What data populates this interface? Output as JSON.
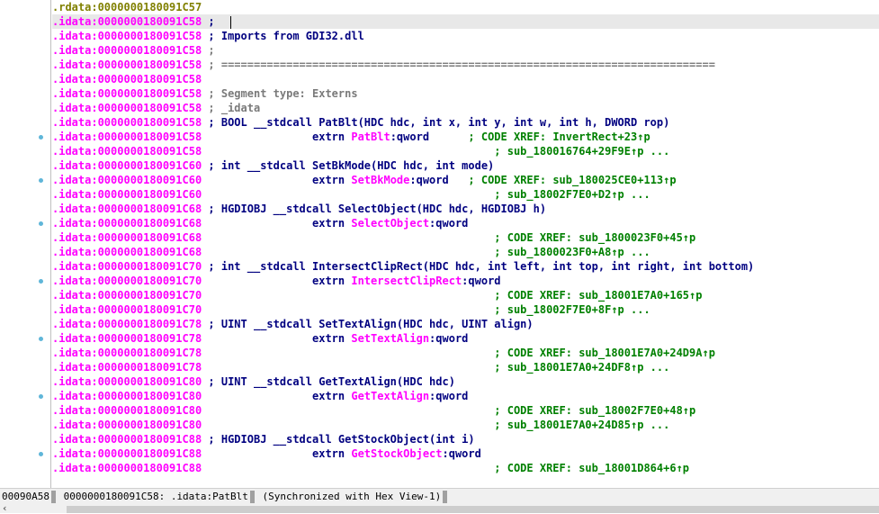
{
  "rows": [
    {
      "seg": "rdata",
      "addr": ".rdata:0000000180091C57",
      "text": ""
    },
    {
      "seg": "idata",
      "addr": ".idata:0000000180091C58",
      "text": " ; ",
      "sel": true,
      "caret": true
    },
    {
      "seg": "idata",
      "addr": ".idata:0000000180091C58",
      "parts": [
        {
          "c": "decl",
          "t": " ; Imports from GDI32.dll"
        }
      ]
    },
    {
      "seg": "idata",
      "addr": ".idata:0000000180091C58",
      "parts": [
        {
          "c": "cmt",
          "t": " ;"
        }
      ]
    },
    {
      "seg": "idata",
      "addr": ".idata:0000000180091C58",
      "parts": [
        {
          "c": "cmt",
          "t": " ; ============================================================================"
        }
      ]
    },
    {
      "seg": "idata",
      "addr": ".idata:0000000180091C58",
      "parts": []
    },
    {
      "seg": "idata",
      "addr": ".idata:0000000180091C58",
      "parts": [
        {
          "c": "cmt",
          "t": " ; Segment type: Externs"
        }
      ]
    },
    {
      "seg": "idata",
      "addr": ".idata:0000000180091C58",
      "parts": [
        {
          "c": "cmt",
          "t": " ; _idata"
        }
      ]
    },
    {
      "seg": "idata",
      "addr": ".idata:0000000180091C58",
      "parts": [
        {
          "c": "decl",
          "t": " ; BOOL __stdcall PatBlt(HDC hdc, int x, int y, int w, int h, DWORD rop)"
        }
      ]
    },
    {
      "seg": "idata",
      "addr": ".idata:0000000180091C58",
      "dot": true,
      "parts": [
        {
          "c": "plain",
          "t": "                 extrn "
        },
        {
          "c": "name",
          "t": "PatBlt"
        },
        {
          "c": "plain",
          "t": ":qword      "
        },
        {
          "c": "xref",
          "t": "; CODE XREF: InvertRect+23↑p"
        }
      ]
    },
    {
      "seg": "idata",
      "addr": ".idata:0000000180091C58",
      "parts": [
        {
          "c": "plain",
          "t": "                                             "
        },
        {
          "c": "xref",
          "t": "; sub_180016764+29F9E↑p ..."
        }
      ]
    },
    {
      "seg": "idata",
      "addr": ".idata:0000000180091C60",
      "parts": [
        {
          "c": "decl",
          "t": " ; int __stdcall SetBkMode(HDC hdc, int mode)"
        }
      ]
    },
    {
      "seg": "idata",
      "addr": ".idata:0000000180091C60",
      "dot": true,
      "parts": [
        {
          "c": "plain",
          "t": "                 extrn "
        },
        {
          "c": "name",
          "t": "SetBkMode"
        },
        {
          "c": "plain",
          "t": ":qword   "
        },
        {
          "c": "xref",
          "t": "; CODE XREF: sub_180025CE0+113↑p"
        }
      ]
    },
    {
      "seg": "idata",
      "addr": ".idata:0000000180091C60",
      "parts": [
        {
          "c": "plain",
          "t": "                                             "
        },
        {
          "c": "xref",
          "t": "; sub_18002F7E0+D2↑p ..."
        }
      ]
    },
    {
      "seg": "idata",
      "addr": ".idata:0000000180091C68",
      "parts": [
        {
          "c": "decl",
          "t": " ; HGDIOBJ __stdcall SelectObject(HDC hdc, HGDIOBJ h)"
        }
      ]
    },
    {
      "seg": "idata",
      "addr": ".idata:0000000180091C68",
      "dot": true,
      "parts": [
        {
          "c": "plain",
          "t": "                 extrn "
        },
        {
          "c": "name",
          "t": "SelectObject"
        },
        {
          "c": "plain",
          "t": ":qword"
        }
      ]
    },
    {
      "seg": "idata",
      "addr": ".idata:0000000180091C68",
      "parts": [
        {
          "c": "plain",
          "t": "                                             "
        },
        {
          "c": "xref",
          "t": "; CODE XREF: sub_1800023F0+45↑p"
        }
      ]
    },
    {
      "seg": "idata",
      "addr": ".idata:0000000180091C68",
      "parts": [
        {
          "c": "plain",
          "t": "                                             "
        },
        {
          "c": "xref",
          "t": "; sub_1800023F0+A8↑p ..."
        }
      ]
    },
    {
      "seg": "idata",
      "addr": ".idata:0000000180091C70",
      "parts": [
        {
          "c": "decl",
          "t": " ; int __stdcall IntersectClipRect(HDC hdc, int left, int top, int right, int bottom)"
        }
      ]
    },
    {
      "seg": "idata",
      "addr": ".idata:0000000180091C70",
      "dot": true,
      "parts": [
        {
          "c": "plain",
          "t": "                 extrn "
        },
        {
          "c": "name",
          "t": "IntersectClipRect"
        },
        {
          "c": "plain",
          "t": ":qword"
        }
      ]
    },
    {
      "seg": "idata",
      "addr": ".idata:0000000180091C70",
      "parts": [
        {
          "c": "plain",
          "t": "                                             "
        },
        {
          "c": "xref",
          "t": "; CODE XREF: sub_18001E7A0+165↑p"
        }
      ]
    },
    {
      "seg": "idata",
      "addr": ".idata:0000000180091C70",
      "parts": [
        {
          "c": "plain",
          "t": "                                             "
        },
        {
          "c": "xref",
          "t": "; sub_18002F7E0+8F↑p ..."
        }
      ]
    },
    {
      "seg": "idata",
      "addr": ".idata:0000000180091C78",
      "parts": [
        {
          "c": "decl",
          "t": " ; UINT __stdcall SetTextAlign(HDC hdc, UINT align)"
        }
      ]
    },
    {
      "seg": "idata",
      "addr": ".idata:0000000180091C78",
      "dot": true,
      "parts": [
        {
          "c": "plain",
          "t": "                 extrn "
        },
        {
          "c": "name",
          "t": "SetTextAlign"
        },
        {
          "c": "plain",
          "t": ":qword"
        }
      ]
    },
    {
      "seg": "idata",
      "addr": ".idata:0000000180091C78",
      "parts": [
        {
          "c": "plain",
          "t": "                                             "
        },
        {
          "c": "xref",
          "t": "; CODE XREF: sub_18001E7A0+24D9A↑p"
        }
      ]
    },
    {
      "seg": "idata",
      "addr": ".idata:0000000180091C78",
      "parts": [
        {
          "c": "plain",
          "t": "                                             "
        },
        {
          "c": "xref",
          "t": "; sub_18001E7A0+24DF8↑p ..."
        }
      ]
    },
    {
      "seg": "idata",
      "addr": ".idata:0000000180091C80",
      "parts": [
        {
          "c": "decl",
          "t": " ; UINT __stdcall GetTextAlign(HDC hdc)"
        }
      ]
    },
    {
      "seg": "idata",
      "addr": ".idata:0000000180091C80",
      "dot": true,
      "parts": [
        {
          "c": "plain",
          "t": "                 extrn "
        },
        {
          "c": "name",
          "t": "GetTextAlign"
        },
        {
          "c": "plain",
          "t": ":qword"
        }
      ]
    },
    {
      "seg": "idata",
      "addr": ".idata:0000000180091C80",
      "parts": [
        {
          "c": "plain",
          "t": "                                             "
        },
        {
          "c": "xref",
          "t": "; CODE XREF: sub_18002F7E0+48↑p"
        }
      ]
    },
    {
      "seg": "idata",
      "addr": ".idata:0000000180091C80",
      "parts": [
        {
          "c": "plain",
          "t": "                                             "
        },
        {
          "c": "xref",
          "t": "; sub_18001E7A0+24D85↑p ..."
        }
      ]
    },
    {
      "seg": "idata",
      "addr": ".idata:0000000180091C88",
      "parts": [
        {
          "c": "decl",
          "t": " ; HGDIOBJ __stdcall GetStockObject(int i)"
        }
      ]
    },
    {
      "seg": "idata",
      "addr": ".idata:0000000180091C88",
      "dot": true,
      "parts": [
        {
          "c": "plain",
          "t": "                 extrn "
        },
        {
          "c": "name",
          "t": "GetStockObject"
        },
        {
          "c": "plain",
          "t": ":qword"
        }
      ]
    },
    {
      "seg": "idata",
      "addr": ".idata:0000000180091C88",
      "parts": [
        {
          "c": "plain",
          "t": "                                             "
        },
        {
          "c": "xref",
          "t": "; CODE XREF: sub_18001D864+6↑p"
        }
      ]
    }
  ],
  "status": {
    "offset": "00090A58",
    "location": "0000000180091C58: .idata:PatBlt",
    "sync": "(Synchronized with Hex View-1)"
  },
  "colors": {
    "address_idata": "#ff00ff",
    "address_rdata": "#808000",
    "comment": "#7a7a7a",
    "declaration": "#000080",
    "xref": "#008000",
    "breakpoint_dot": "#5fb6d9"
  }
}
